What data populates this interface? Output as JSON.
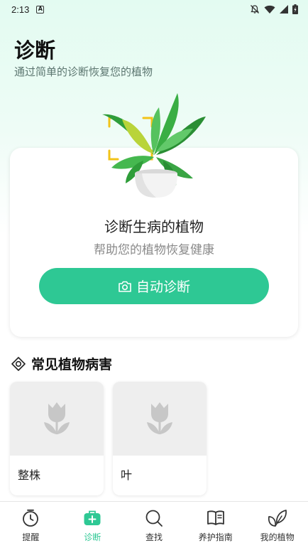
{
  "status_bar": {
    "time": "2:13",
    "icons": [
      "notification-a-icon",
      "bell-off-icon",
      "wifi-icon",
      "signal-icon",
      "battery-icon"
    ]
  },
  "header": {
    "title": "诊断",
    "subtitle": "通过简单的诊断恢复您的植物"
  },
  "diagnose_card": {
    "title": "诊断生病的植物",
    "subtitle": "帮助您的植物恢复健康",
    "button_label": "自动诊断",
    "button_icon": "camera-icon"
  },
  "common_diseases": {
    "title": "常见植物病害",
    "icon": "target-icon",
    "items": [
      {
        "label": "整株",
        "icon": "tulip-placeholder-icon"
      },
      {
        "label": "叶",
        "icon": "tulip-placeholder-icon"
      }
    ]
  },
  "bottom_nav": {
    "items": [
      {
        "label": "提醒",
        "icon": "clock-icon",
        "active": false
      },
      {
        "label": "诊断",
        "icon": "medical-kit-icon",
        "active": true
      },
      {
        "label": "查找",
        "icon": "search-icon",
        "active": false
      },
      {
        "label": "养护指南",
        "icon": "book-icon",
        "active": false
      },
      {
        "label": "我的植物",
        "icon": "leaves-icon",
        "active": false
      }
    ]
  },
  "colors": {
    "accent": "#2ec894",
    "header_gradient": "#e3fbf1",
    "muted_text": "#8a8a8a"
  }
}
